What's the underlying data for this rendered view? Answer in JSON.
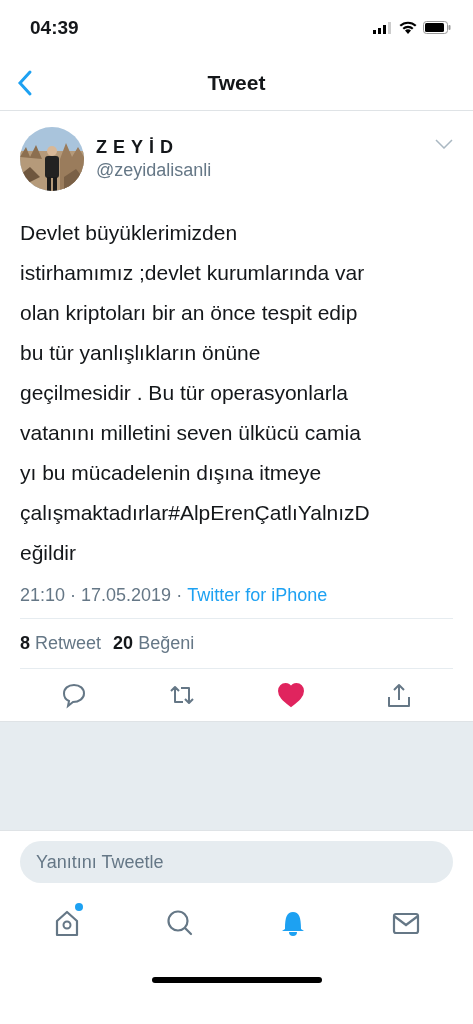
{
  "status_bar": {
    "time": "04:39"
  },
  "nav": {
    "title": "Tweet"
  },
  "tweet": {
    "author": {
      "name": "ZEYİD",
      "handle": "@zeyidalisanli"
    },
    "text": "Devlet büyüklerimizden\nistirhamımız ;devlet kurumlarında var\nolan kriptoları bir an önce tespit edip\nbu tür yanlışlıkların önüne\ngeçilmesidir . Bu tür operasyonlarla\nvatanını milletini seven ülkücü camia\nyı bu mücadelenin dışına itmeye\nçalışmaktadırlar#AlpErenÇatlıYalnızD\neğildir",
    "time": "21:10 · 17.05.2019 ·",
    "source": "Twitter for iPhone",
    "stats": [
      {
        "count": "8",
        "label": "Retweet"
      },
      {
        "count": "20",
        "label": "Beğeni"
      }
    ],
    "liked": true
  },
  "reply": {
    "placeholder": "Yanıtını Tweetle"
  },
  "tab_bar": [
    {
      "kind": "home",
      "selected": false,
      "badge": true
    },
    {
      "kind": "search",
      "selected": false,
      "badge": false
    },
    {
      "kind": "notifications",
      "selected": true,
      "badge": false
    },
    {
      "kind": "messages",
      "selected": false,
      "badge": false
    }
  ]
}
